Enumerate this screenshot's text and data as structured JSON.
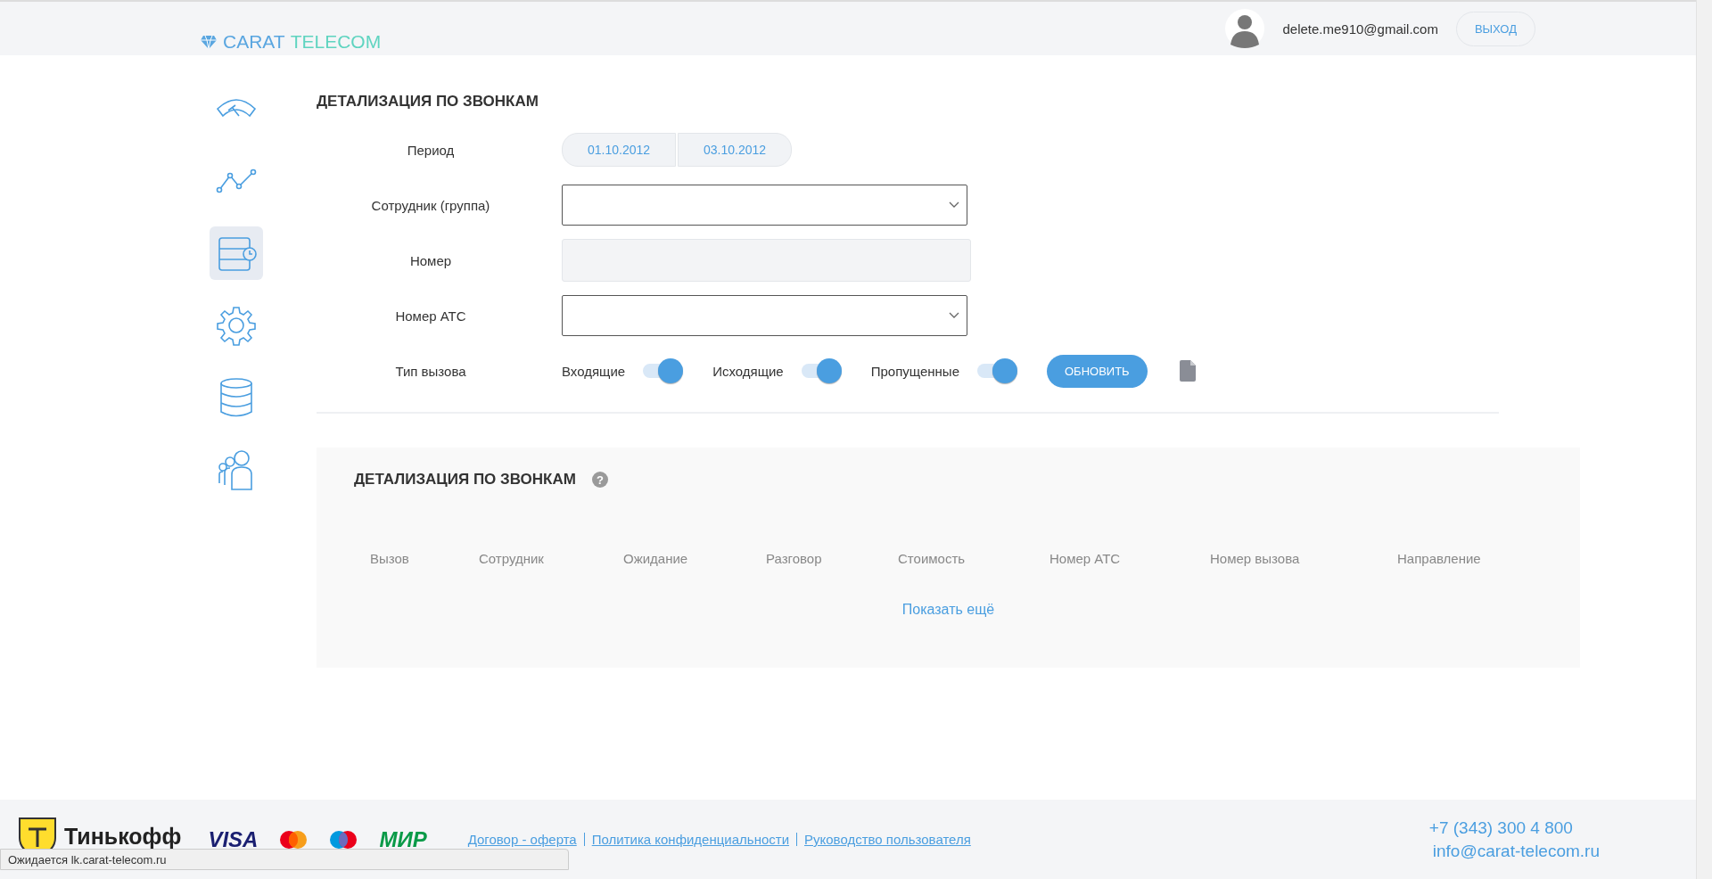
{
  "header": {
    "logo": {
      "part_1": "CARAT",
      "part_2": "TELECOM"
    },
    "user_email": "delete.me910@gmail.com",
    "logout_button": "ВЫХОД"
  },
  "sidebar": {
    "items": [
      {
        "kind": "gauge",
        "selected": false
      },
      {
        "kind": "chart",
        "selected": false
      },
      {
        "kind": "calls",
        "selected": true
      },
      {
        "kind": "settings",
        "selected": false
      },
      {
        "kind": "database",
        "selected": false
      },
      {
        "kind": "users",
        "selected": false
      }
    ]
  },
  "filter": {
    "title": "ДЕТАЛИЗАЦИЯ ПО ЗВОНКАМ",
    "period": {
      "label": "Период",
      "from": "01.10.2012",
      "to": "03.10.2012"
    },
    "employee": {
      "label": "Сотрудник (группа)"
    },
    "number": {
      "label": "Номер",
      "disabled": true
    },
    "pbx_number": {
      "label": "Номер АТС"
    },
    "call_type": {
      "label": "Тип вызова",
      "toggles": [
        {
          "label": "Входящие",
          "on": true
        },
        {
          "label": "Исходящие",
          "on": true
        },
        {
          "label": "Пропущенные",
          "on": true
        }
      ]
    },
    "refresh_button": "ОБНОВИТЬ"
  },
  "report": {
    "title": "ДЕТАЛИЗАЦИЯ ПО ЗВОНКАМ",
    "help": "?",
    "columns": [
      "Вызов",
      "Сотрудник",
      "Ожидание",
      "Разговор",
      "Стоимость",
      "Номер АТС",
      "Номер вызова",
      "Направление"
    ],
    "show_more": "Показать ещё"
  },
  "footer": {
    "bank": "Тинькофф",
    "payments": [
      {
        "kind": "visa",
        "label": "VISA"
      },
      {
        "kind": "mastercard"
      },
      {
        "kind": "maestro"
      },
      {
        "kind": "mir",
        "label": "МИР"
      }
    ],
    "links": [
      "Договор - оферта",
      "Политика конфиденциальности",
      "Руководство пользователя"
    ],
    "phone": "+7 (343) 300 4 800",
    "email": "info@carat-telecom.ru"
  },
  "status_bar": "Ожидается lk.carat-telecom.ru"
}
